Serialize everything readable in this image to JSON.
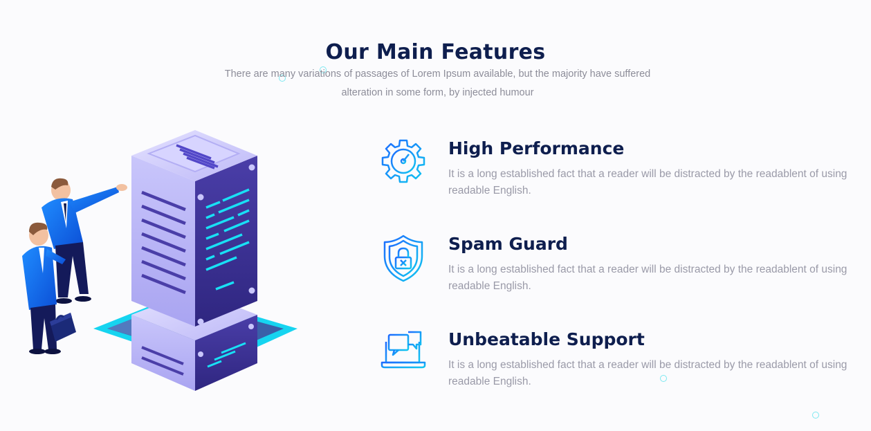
{
  "section": {
    "title": "Our Main Features",
    "subtitle": "There are many variations of passages of Lorem Ipsum available, but the majority have suffered alteration in some form, by injected humour"
  },
  "illustration": {
    "icon": "server-rack-with-people-illustration"
  },
  "features": [
    {
      "title": "High Performance",
      "description": "It is a long established fact that a reader will be distracted by the readablent of using readable English.",
      "icon": "gear-speedometer-icon"
    },
    {
      "title": "Spam Guard",
      "description": "It is a long established fact that a reader will be distracted by the readablent of using readable English.",
      "icon": "shield-lock-icon"
    },
    {
      "title": "Unbeatable Support",
      "description": "It is a long established fact that a reader will be distracted by the readablent of using readable English.",
      "icon": "laptop-chat-icon"
    }
  ],
  "colors": {
    "heading": "#0e1e4e",
    "body_text": "#9a9aa8",
    "accent_gradient_start": "#1e6bff",
    "accent_gradient_end": "#11c7f0"
  }
}
